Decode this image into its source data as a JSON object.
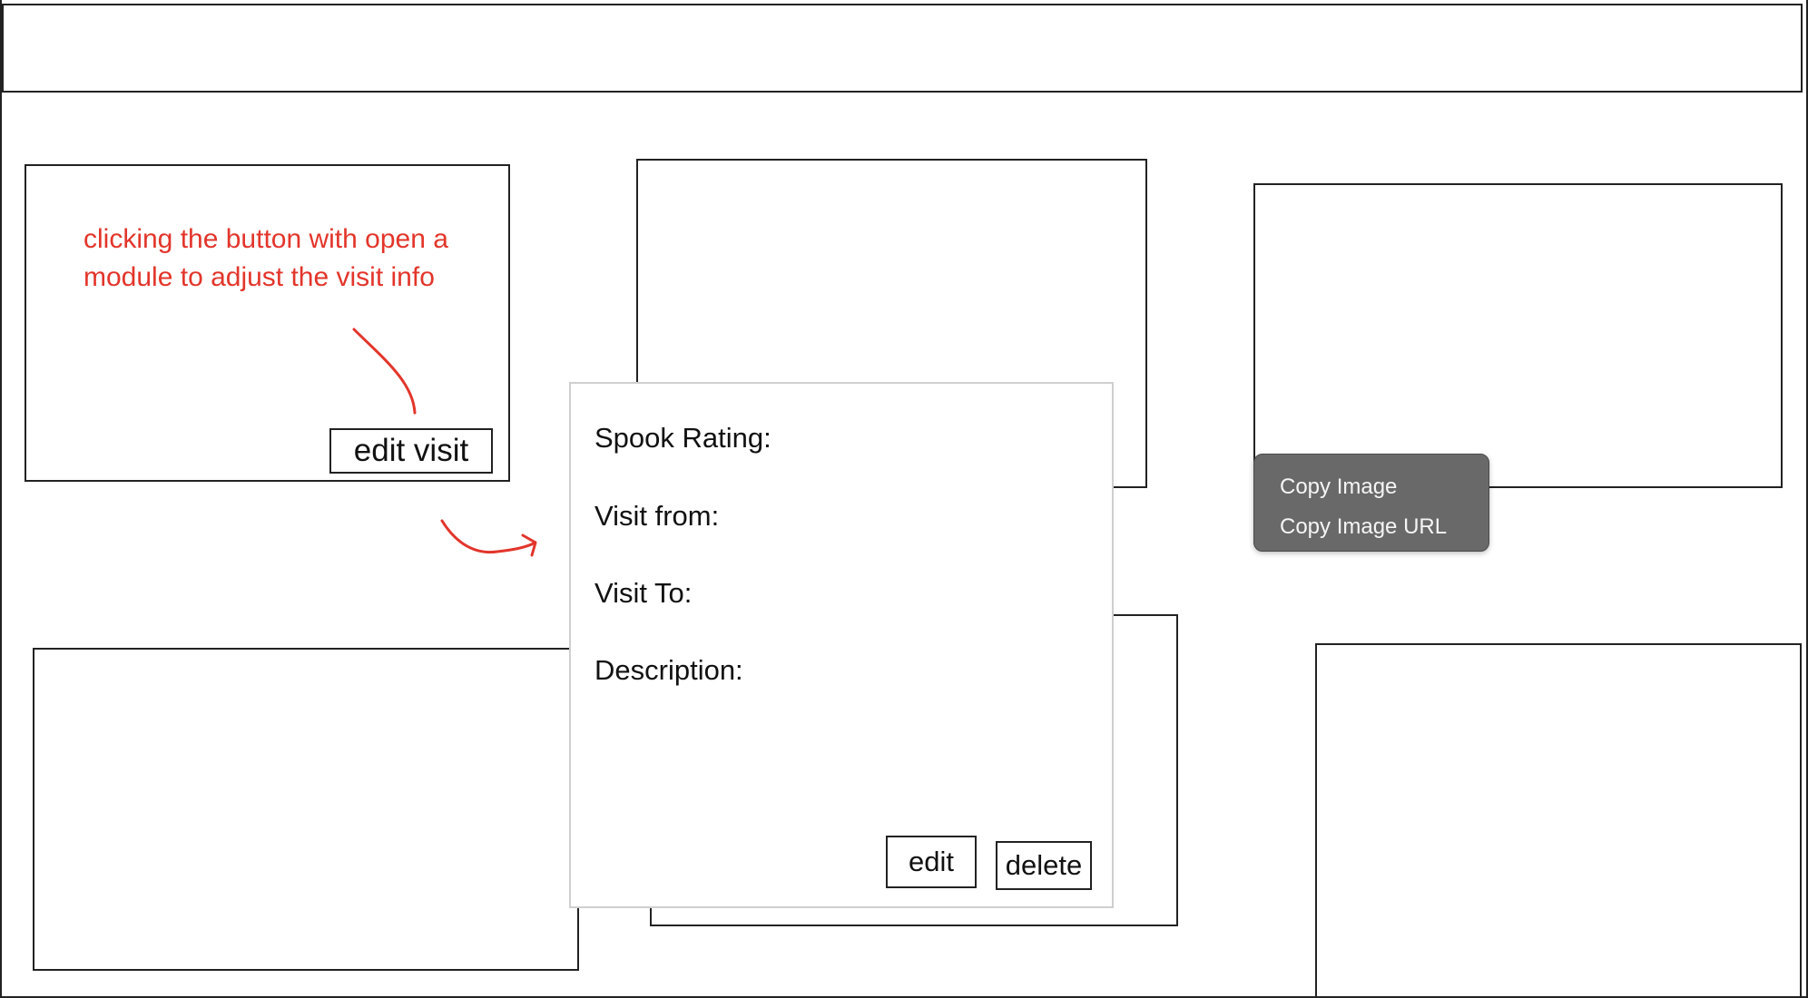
{
  "annotation": {
    "note_text": "clicking the button with open a module to adjust the visit info",
    "annotation_color": "#e3352b"
  },
  "card": {
    "edit_button_label": "edit visit"
  },
  "modal": {
    "spook_rating_label": "Spook Rating:",
    "visit_from_label": "Visit from:",
    "visit_to_label": "Visit To:",
    "description_label": "Description:",
    "edit_button_label": "edit",
    "delete_button_label": "delete"
  },
  "context_menu": {
    "items": [
      {
        "label": "Copy Image"
      },
      {
        "label": "Copy Image URL"
      }
    ],
    "background_color": "#696969"
  }
}
